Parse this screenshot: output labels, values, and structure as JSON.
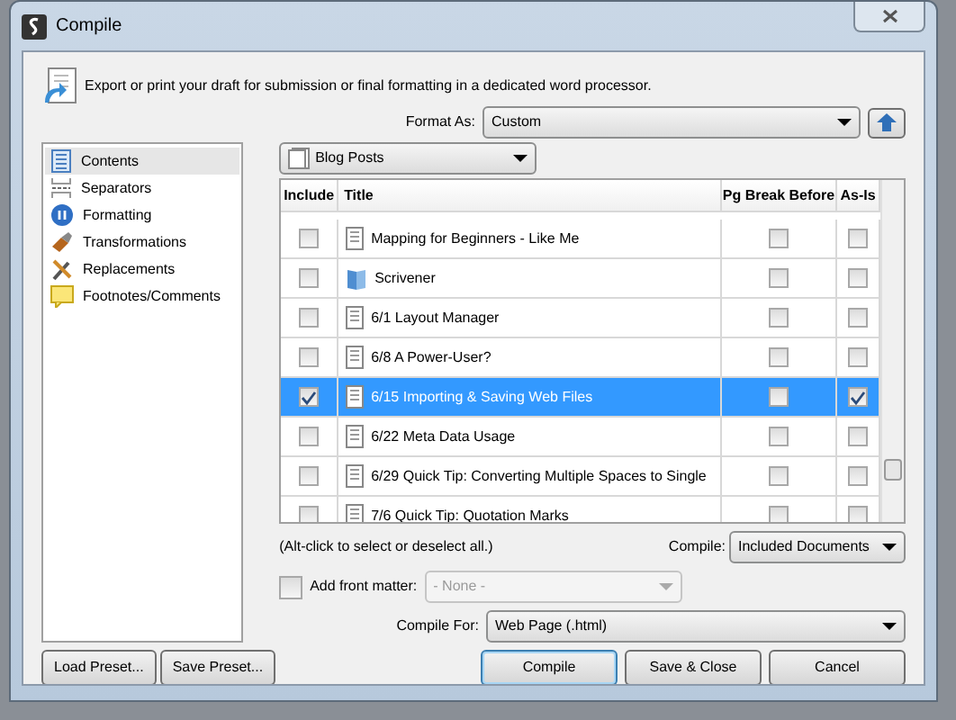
{
  "window": {
    "title": "Compile"
  },
  "description": "Export or print your draft for submission or final formatting in a dedicated word processor.",
  "format_as": {
    "label": "Format As:",
    "value": "Custom"
  },
  "sidebar": {
    "items": [
      {
        "label": "Contents",
        "selected": true
      },
      {
        "label": "Separators",
        "selected": false
      },
      {
        "label": "Formatting",
        "selected": false
      },
      {
        "label": "Transformations",
        "selected": false
      },
      {
        "label": "Replacements",
        "selected": false
      },
      {
        "label": "Footnotes/Comments",
        "selected": false
      }
    ]
  },
  "collection": {
    "value": "Blog Posts"
  },
  "table": {
    "columns": [
      "Include",
      "Title",
      "Pg Break Before",
      "As-Is"
    ],
    "rows": [
      {
        "kind": "document",
        "title": "Mapping for Beginners - Like Me",
        "include": false,
        "pg_break": false,
        "as_is": false,
        "selected": false
      },
      {
        "kind": "folder",
        "title": "Scrivener",
        "include": false,
        "pg_break": false,
        "as_is": false,
        "selected": false
      },
      {
        "kind": "document",
        "title": "6/1 Layout Manager",
        "include": false,
        "pg_break": false,
        "as_is": false,
        "selected": false
      },
      {
        "kind": "document",
        "title": "6/8 A Power-User?",
        "include": false,
        "pg_break": false,
        "as_is": false,
        "selected": false
      },
      {
        "kind": "document",
        "title": "6/15 Importing & Saving Web Files",
        "include": true,
        "pg_break": false,
        "as_is": true,
        "selected": true
      },
      {
        "kind": "document",
        "title": "6/22 Meta Data Usage",
        "include": false,
        "pg_break": false,
        "as_is": false,
        "selected": false
      },
      {
        "kind": "document",
        "title": "6/29 Quick Tip: Converting Multiple Spaces to Single",
        "include": false,
        "pg_break": false,
        "as_is": false,
        "selected": false
      },
      {
        "kind": "document",
        "title": "7/6 Quick Tip: Quotation Marks",
        "include": false,
        "pg_break": false,
        "as_is": false,
        "selected": false
      }
    ]
  },
  "hint": "(Alt-click to select or deselect all.)",
  "compile": {
    "label": "Compile:",
    "value": "Included Documents"
  },
  "front_matter": {
    "label": "Add front matter:",
    "checked": false,
    "value": "- None -",
    "disabled": true
  },
  "compile_for": {
    "label": "Compile For:",
    "value": "Web Page (.html)"
  },
  "preset_buttons": [
    "Load Preset...",
    "Save Preset..."
  ],
  "buttons": [
    {
      "label": "Compile",
      "default": true
    },
    {
      "label": "Save & Close",
      "default": false
    },
    {
      "label": "Cancel",
      "default": false
    }
  ]
}
